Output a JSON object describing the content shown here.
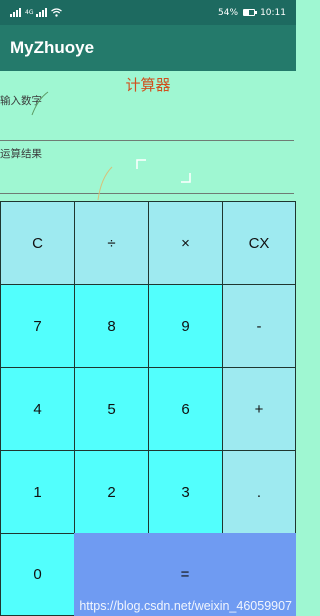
{
  "status_bar": {
    "left_icons": [
      "sim-signal-icon",
      "mobile-signal-icon",
      "wifi-icon"
    ],
    "network_label": "4G",
    "battery": "54%",
    "battery_level": 0.54,
    "time": "10:11"
  },
  "app_bar": {
    "title": "MyZhuoye"
  },
  "calculator": {
    "title": "计算器",
    "input_label": "输入数字",
    "input_value": "",
    "result_label": "运算结果",
    "result_value": ""
  },
  "keys": {
    "clear": "C",
    "divide": "÷",
    "multiply": "×",
    "backspace": "CX",
    "seven": "7",
    "eight": "8",
    "nine": "9",
    "minus": "-",
    "four": "4",
    "five": "5",
    "six": "6",
    "plus": "+",
    "one": "1",
    "two": "2",
    "three": "3",
    "dot": ".",
    "zero": "0",
    "equals": "="
  },
  "colors": {
    "status_bar": "#1d6a60",
    "app_bar": "#247a6b",
    "background": "#9ff7d2",
    "title": "#d0501e",
    "key_light": "#9eeaf0",
    "key_cyan": "#52fffd",
    "key_blue": "#6f9bf2"
  },
  "watermark": "https://blog.csdn.net/weixin_46059907"
}
